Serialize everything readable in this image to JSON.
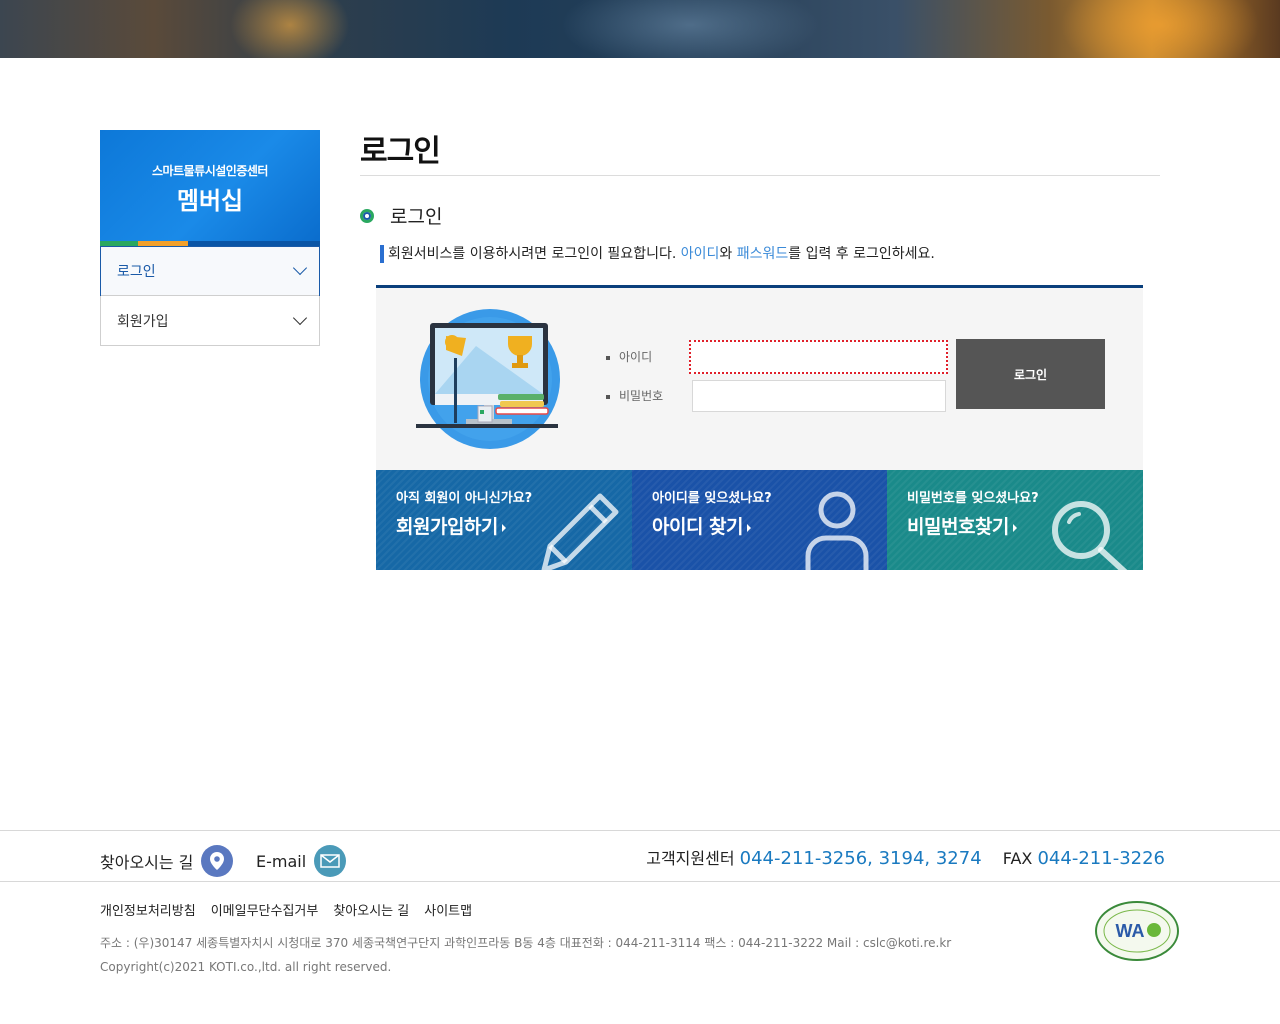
{
  "sidebar": {
    "org": "스마트물류시설인증센터",
    "title": "멤버십",
    "items": [
      {
        "label": "로그인"
      },
      {
        "label": "회원가입"
      }
    ]
  },
  "main": {
    "page_title": "로그인",
    "section_title": "로그인",
    "notice": {
      "before": "회원서비스를 이용하시려면 로그인이 필요합니다. ",
      "id_word": "아이디",
      "and": "와 ",
      "pw_word": "패스워드",
      "after": "를 입력 후 로그인하세요."
    },
    "form": {
      "id_label": "아이디",
      "pw_label": "비밀번호",
      "id_value": "",
      "pw_value": "",
      "login_button": "로그인"
    },
    "tiles": [
      {
        "question": "아직 회원이 아니신가요?",
        "action": "회원가입하기"
      },
      {
        "question": "아이디를 잊으셨나요?",
        "action": "아이디 찾기"
      },
      {
        "question": "비밀번호를 잊으셨나요?",
        "action": "비밀번호찾기"
      }
    ]
  },
  "footer": {
    "directions": "찾아오시는 길",
    "email": "E-mail",
    "support_label": "고객지원센터",
    "support_numbers": "044-211-3256, 3194, 3274",
    "fax_label": "FAX",
    "fax_number": "044-211-3226",
    "links": [
      "개인정보처리방침",
      "이메일무단수집거부",
      "찾아오시는 길",
      "사이트맵"
    ],
    "address": "주소 : (우)30147 세종특별자치시 시청대로 370 세종국책연구단지 과학인프라동 B동 4층 대표전화 : 044-211-3114 팩스 : 044-211-3222 Mail : cslc@koti.re.kr",
    "copyright": "Copyright(c)2021 KOTI.co.,ltd. all right reserved.",
    "badge_text": "WA"
  },
  "colors": {
    "primary_blue": "#0d78d8",
    "navy": "#0a3f7c",
    "link_blue": "#3a8ad8",
    "tile_join": "#1668a6",
    "tile_id": "#1a52a8",
    "tile_pw": "#1a8a8a",
    "login_btn": "#555555"
  }
}
